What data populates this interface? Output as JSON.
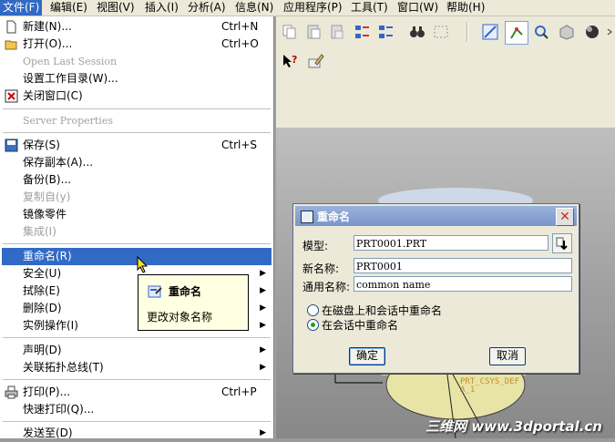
{
  "menubar": [
    {
      "label": "文件(F)"
    },
    {
      "label": "编辑(E)"
    },
    {
      "label": "视图(V)"
    },
    {
      "label": "插入(I)"
    },
    {
      "label": "分析(A)"
    },
    {
      "label": "信息(N)"
    },
    {
      "label": "应用程序(P)"
    },
    {
      "label": "工具(T)"
    },
    {
      "label": "窗口(W)"
    },
    {
      "label": "帮助(H)"
    }
  ],
  "file_menu": {
    "items": [
      {
        "label": "新建(N)...",
        "shortcut": "Ctrl+N",
        "icon": "new-file-icon"
      },
      {
        "label": "打开(O)...",
        "shortcut": "Ctrl+O",
        "icon": "open-folder-icon"
      },
      {
        "label": "Open Last Session",
        "disabled": true
      },
      {
        "label": "设置工作目录(W)..."
      },
      {
        "label": "关闭窗口(C)",
        "icon": "close-window-icon"
      },
      {
        "label": "Server Properties",
        "disabled": true
      },
      {
        "label": "保存(S)",
        "shortcut": "Ctrl+S",
        "icon": "save-icon"
      },
      {
        "label": "保存副本(A)..."
      },
      {
        "label": "备份(B)..."
      },
      {
        "label": "复制自(y)",
        "disabled": true
      },
      {
        "label": "镜像零件"
      },
      {
        "label": "集成(I)",
        "disabled": true
      },
      {
        "label": "重命名(R)",
        "highlighted": true
      },
      {
        "label": "安全(U)",
        "submenu": true
      },
      {
        "label": "拭除(E)",
        "submenu": true
      },
      {
        "label": "删除(D)",
        "submenu": true
      },
      {
        "label": "实例操作(I)",
        "submenu": true
      },
      {
        "label": "声明(D)",
        "submenu": true
      },
      {
        "label": "关联拓扑总线(T)",
        "submenu": true
      },
      {
        "label": "打印(P)...",
        "shortcut": "Ctrl+P",
        "icon": "print-icon"
      },
      {
        "label": "快速打印(Q)..."
      },
      {
        "label": "发送至(D)",
        "submenu": true
      }
    ]
  },
  "tooltip": {
    "title": "重命名",
    "description": "更改对象名称",
    "icon": "rename-icon"
  },
  "dialog": {
    "title": "重命名",
    "model_label": "模型:",
    "model_value": "PRT0001.PRT",
    "new_name_label": "新名称:",
    "new_name_value": "PRT0001",
    "common_name_label": "通用名称:",
    "common_name_value": "common name",
    "radio_disk_and_session": "在磁盘上和会话中重命名",
    "radio_session": "在会话中重命名",
    "selected_option": "在会话中重命名",
    "ok_label": "确定",
    "cancel_label": "取消"
  },
  "graphics": {
    "csys_label": "PRT_CSYS_DEF",
    "axis_label": "A_1"
  },
  "watermark": "三维网 www.3dportal.cn",
  "colors": {
    "menu_highlight": "#316ac5",
    "window_bg": "#ece9d8",
    "dialog_title": "#7a95c8"
  }
}
